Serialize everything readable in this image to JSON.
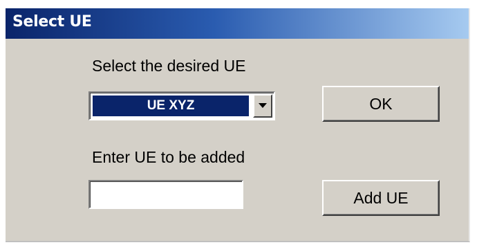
{
  "window": {
    "title": "Select UE"
  },
  "select_section": {
    "label": "Select the desired UE",
    "selected_value": "UE XYZ"
  },
  "add_section": {
    "label": "Enter UE to be added",
    "input_value": "",
    "input_placeholder": ""
  },
  "buttons": {
    "ok_label": "OK",
    "add_label": "Add UE"
  },
  "colors": {
    "titlebar_start": "#0a246a",
    "titlebar_end": "#a6caf0",
    "dialog_bg": "#d4d0c8",
    "selection_bg": "#0a246a"
  },
  "icons": {
    "dropdown": "chevron-down-icon"
  }
}
